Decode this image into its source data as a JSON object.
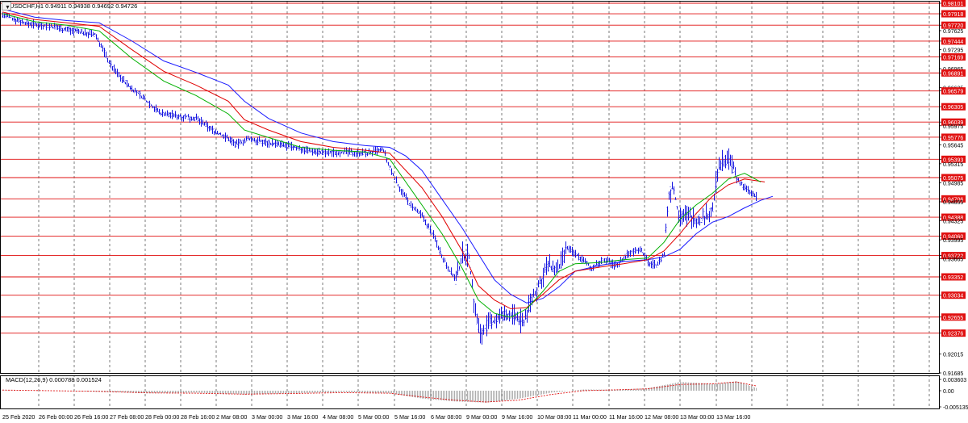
{
  "header": {
    "symbol_line": "USDCHF,H1  0.94911 0.94938 0.94692 0.94726",
    "menu_icon": "triangle-down-icon"
  },
  "chart_data": [
    {
      "type": "line",
      "title": "USDCHF,H1",
      "ohlc_last": {
        "open": 0.94911,
        "high": 0.94938,
        "low": 0.94692,
        "close": 0.94726
      },
      "price_range": [
        0.91685,
        0.98101
      ],
      "grid": true,
      "y_ticks": [
        "0.98101",
        "0.97918",
        "0.97720",
        "0.97625",
        "0.97444",
        "0.97295",
        "0.97169",
        "0.96965",
        "0.96891",
        "0.96635",
        "0.96579",
        "0.96305",
        "0.96039",
        "0.95975",
        "0.95776",
        "0.95645",
        "0.95393",
        "0.95315",
        "0.95075",
        "0.94985",
        "0.94706",
        "0.94655",
        "0.94388",
        "0.94325",
        "0.94060",
        "0.93995",
        "0.93722",
        "0.93665",
        "0.93352",
        "0.93034",
        "0.92655",
        "0.92376",
        "0.92015",
        "0.91685"
      ],
      "horizontal_levels": [
        0.98101,
        0.97918,
        0.9772,
        0.97444,
        0.97169,
        0.96891,
        0.96579,
        0.96305,
        0.96039,
        0.95776,
        0.95393,
        0.95075,
        0.94706,
        0.94388,
        0.9406,
        0.93722,
        0.93352,
        0.93034,
        0.92655,
        0.92376
      ],
      "current_price": 0.94726,
      "x_labels": [
        "25 Feb 2020",
        "26 Feb 00:00",
        "26 Feb 16:00",
        "27 Feb 08:00",
        "28 Feb 00:00",
        "28 Feb 16:00",
        "2 Mar 08:00",
        "3 Mar 00:00",
        "3 Mar 16:00",
        "4 Mar 08:00",
        "5 Mar 00:00",
        "5 Mar 16:00",
        "6 Mar 08:00",
        "9 Mar 00:00",
        "9 Mar 16:00",
        "10 Mar 08:00",
        "11 Mar 00:00",
        "11 Mar 16:00",
        "12 Mar 08:00",
        "13 Mar 00:00",
        "13 Mar 16:00"
      ],
      "price_path": [
        [
          0,
          0.979
        ],
        [
          30,
          0.9775
        ],
        [
          60,
          0.977
        ],
        [
          90,
          0.9762
        ],
        [
          115,
          0.9755
        ],
        [
          135,
          0.97
        ],
        [
          155,
          0.9668
        ],
        [
          175,
          0.9645
        ],
        [
          195,
          0.962
        ],
        [
          215,
          0.9615
        ],
        [
          240,
          0.961
        ],
        [
          260,
          0.959
        ],
        [
          280,
          0.9575
        ],
        [
          290,
          0.9565
        ],
        [
          305,
          0.9575
        ],
        [
          320,
          0.957
        ],
        [
          350,
          0.9563
        ],
        [
          380,
          0.9555
        ],
        [
          400,
          0.955
        ],
        [
          420,
          0.9552
        ],
        [
          450,
          0.955
        ],
        [
          472,
          0.9555
        ],
        [
          478,
          0.953
        ],
        [
          490,
          0.9495
        ],
        [
          505,
          0.946
        ],
        [
          520,
          0.944
        ],
        [
          535,
          0.9405
        ],
        [
          545,
          0.937
        ],
        [
          555,
          0.9345
        ],
        [
          562,
          0.933
        ],
        [
          570,
          0.9375
        ],
        [
          578,
          0.937
        ],
        [
          585,
          0.928
        ],
        [
          592,
          0.9235
        ],
        [
          600,
          0.925
        ],
        [
          615,
          0.9265
        ],
        [
          630,
          0.927
        ],
        [
          645,
          0.9255
        ],
        [
          655,
          0.9295
        ],
        [
          665,
          0.932
        ],
        [
          675,
          0.9355
        ],
        [
          688,
          0.9345
        ],
        [
          700,
          0.9385
        ],
        [
          715,
          0.937
        ],
        [
          730,
          0.935
        ],
        [
          745,
          0.9365
        ],
        [
          760,
          0.9355
        ],
        [
          775,
          0.9375
        ],
        [
          790,
          0.9385
        ],
        [
          800,
          0.936
        ],
        [
          810,
          0.9355
        ],
        [
          820,
          0.9375
        ],
        [
          825,
          0.947
        ],
        [
          830,
          0.9495
        ],
        [
          838,
          0.9445
        ],
        [
          850,
          0.944
        ],
        [
          865,
          0.9435
        ],
        [
          880,
          0.945
        ],
        [
          885,
          0.951
        ],
        [
          893,
          0.954
        ],
        [
          903,
          0.9535
        ],
        [
          910,
          0.9505
        ],
        [
          920,
          0.949
        ],
        [
          928,
          0.948
        ],
        [
          935,
          0.9473
        ]
      ],
      "moving_averages": [
        {
          "color": "#1a1aff",
          "path": [
            [
              0,
              0.98
            ],
            [
              40,
              0.9786
            ],
            [
              80,
              0.978
            ],
            [
              120,
              0.9776
            ],
            [
              160,
              0.9745
            ],
            [
              200,
              0.971
            ],
            [
              240,
              0.969
            ],
            [
              280,
              0.9668
            ],
            [
              300,
              0.964
            ],
            [
              330,
              0.961
            ],
            [
              370,
              0.9585
            ],
            [
              410,
              0.957
            ],
            [
              450,
              0.9563
            ],
            [
              480,
              0.956
            ],
            [
              500,
              0.9545
            ],
            [
              520,
              0.952
            ],
            [
              545,
              0.947
            ],
            [
              570,
              0.942
            ],
            [
              590,
              0.9375
            ],
            [
              610,
              0.933
            ],
            [
              630,
              0.9305
            ],
            [
              650,
              0.929
            ],
            [
              670,
              0.9298
            ],
            [
              690,
              0.9318
            ],
            [
              710,
              0.9345
            ],
            [
              740,
              0.9355
            ],
            [
              770,
              0.9362
            ],
            [
              800,
              0.9365
            ],
            [
              820,
              0.937
            ],
            [
              840,
              0.9383
            ],
            [
              860,
              0.941
            ],
            [
              880,
              0.943
            ],
            [
              900,
              0.944
            ],
            [
              920,
              0.9455
            ],
            [
              940,
              0.9468
            ],
            [
              955,
              0.9475
            ]
          ]
        },
        {
          "color": "#e00000",
          "path": [
            [
              0,
              0.9795
            ],
            [
              40,
              0.9782
            ],
            [
              80,
              0.9776
            ],
            [
              120,
              0.977
            ],
            [
              160,
              0.973
            ],
            [
              200,
              0.9692
            ],
            [
              240,
              0.9668
            ],
            [
              280,
              0.964
            ],
            [
              300,
              0.9608
            ],
            [
              330,
              0.959
            ],
            [
              370,
              0.957
            ],
            [
              410,
              0.956
            ],
            [
              450,
              0.9555
            ],
            [
              480,
              0.955
            ],
            [
              500,
              0.952
            ],
            [
              520,
              0.949
            ],
            [
              545,
              0.944
            ],
            [
              570,
              0.938
            ],
            [
              590,
              0.932
            ],
            [
              610,
              0.9295
            ],
            [
              630,
              0.928
            ],
            [
              650,
              0.9282
            ],
            [
              670,
              0.9305
            ],
            [
              690,
              0.933
            ],
            [
              710,
              0.9345
            ],
            [
              740,
              0.9352
            ],
            [
              770,
              0.9358
            ],
            [
              800,
              0.9365
            ],
            [
              820,
              0.938
            ],
            [
              840,
              0.941
            ],
            [
              860,
              0.9445
            ],
            [
              880,
              0.9475
            ],
            [
              900,
              0.9495
            ],
            [
              920,
              0.9505
            ],
            [
              945,
              0.95
            ]
          ]
        },
        {
          "color": "#00b000",
          "path": [
            [
              0,
              0.9792
            ],
            [
              40,
              0.9778
            ],
            [
              80,
              0.9772
            ],
            [
              120,
              0.9762
            ],
            [
              160,
              0.9715
            ],
            [
              200,
              0.9675
            ],
            [
              240,
              0.965
            ],
            [
              280,
              0.9618
            ],
            [
              300,
              0.959
            ],
            [
              330,
              0.9577
            ],
            [
              370,
              0.956
            ],
            [
              410,
              0.9555
            ],
            [
              450,
              0.9552
            ],
            [
              480,
              0.954
            ],
            [
              500,
              0.95
            ],
            [
              520,
              0.946
            ],
            [
              545,
              0.941
            ],
            [
              570,
              0.935
            ],
            [
              590,
              0.9295
            ],
            [
              610,
              0.9272
            ],
            [
              630,
              0.9265
            ],
            [
              650,
              0.928
            ],
            [
              670,
              0.931
            ],
            [
              690,
              0.9345
            ],
            [
              710,
              0.9358
            ],
            [
              740,
              0.936
            ],
            [
              770,
              0.9365
            ],
            [
              800,
              0.9368
            ],
            [
              820,
              0.9395
            ],
            [
              840,
              0.9435
            ],
            [
              860,
              0.946
            ],
            [
              880,
              0.948
            ],
            [
              900,
              0.9505
            ],
            [
              920,
              0.9515
            ],
            [
              940,
              0.95
            ]
          ]
        }
      ]
    },
    {
      "type": "bar",
      "title": "MACD(12,26,9) 0.000788 0.001524",
      "y_ticks": [
        "0.003603",
        "0.00",
        "-0.005135"
      ],
      "range": [
        -0.005135,
        0.003603
      ],
      "histogram": [
        [
          0,
          0.0001
        ],
        [
          60,
          0.0
        ],
        [
          120,
          -0.0003
        ],
        [
          180,
          -0.0008
        ],
        [
          240,
          -0.0006
        ],
        [
          300,
          -0.0012
        ],
        [
          360,
          -0.0008
        ],
        [
          420,
          -0.0004
        ],
        [
          480,
          -0.0008
        ],
        [
          520,
          -0.0025
        ],
        [
          560,
          -0.0034
        ],
        [
          600,
          -0.0038
        ],
        [
          640,
          -0.0025
        ],
        [
          680,
          -0.0006
        ],
        [
          720,
          0.0004
        ],
        [
          760,
          0.0003
        ],
        [
          800,
          0.0008
        ],
        [
          840,
          0.0028
        ],
        [
          880,
          0.0022
        ],
        [
          910,
          0.003
        ],
        [
          935,
          0.0008
        ]
      ],
      "signal": [
        [
          0,
          0.0002
        ],
        [
          60,
          0.0
        ],
        [
          120,
          -0.0002
        ],
        [
          180,
          -0.0007
        ],
        [
          240,
          -0.0008
        ],
        [
          300,
          -0.0011
        ],
        [
          360,
          -0.0009
        ],
        [
          420,
          -0.0006
        ],
        [
          480,
          -0.0008
        ],
        [
          520,
          -0.002
        ],
        [
          560,
          -0.003
        ],
        [
          600,
          -0.0036
        ],
        [
          640,
          -0.003
        ],
        [
          680,
          -0.0012
        ],
        [
          720,
          0.0
        ],
        [
          760,
          0.0003
        ],
        [
          800,
          0.0006
        ],
        [
          840,
          0.002
        ],
        [
          880,
          0.0022
        ],
        [
          910,
          0.0028
        ],
        [
          935,
          0.0015
        ]
      ]
    }
  ]
}
